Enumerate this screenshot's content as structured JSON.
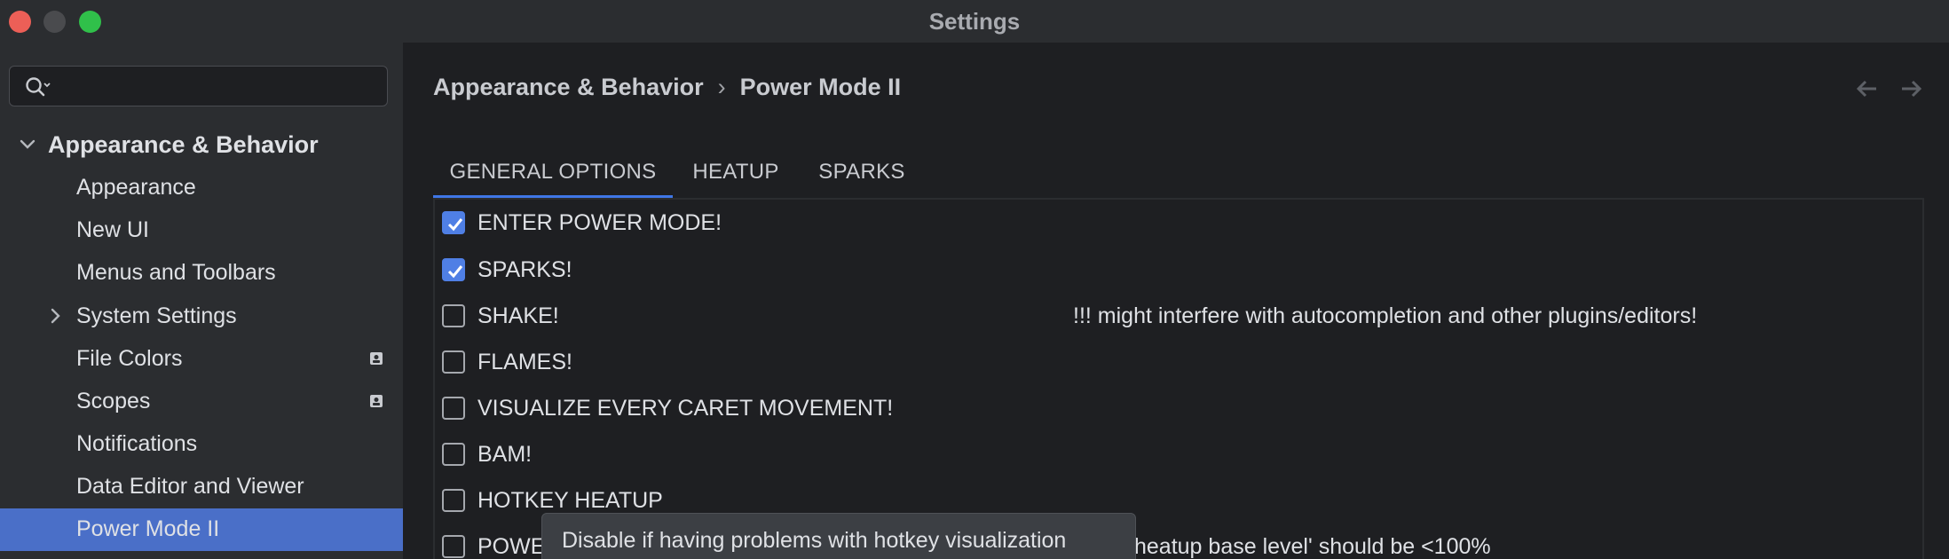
{
  "window": {
    "title": "Settings"
  },
  "search": {
    "placeholder": "",
    "value": ""
  },
  "sidebar": {
    "items": [
      {
        "label": "Appearance & Behavior"
      },
      {
        "label": "Appearance"
      },
      {
        "label": "New UI"
      },
      {
        "label": "Menus and Toolbars"
      },
      {
        "label": "System Settings"
      },
      {
        "label": "File Colors"
      },
      {
        "label": "Scopes"
      },
      {
        "label": "Notifications"
      },
      {
        "label": "Data Editor and Viewer"
      },
      {
        "label": "Power Mode II"
      }
    ]
  },
  "breadcrumb": {
    "parent": "Appearance & Behavior",
    "separator": "›",
    "current": "Power Mode II"
  },
  "tabs": [
    {
      "label": "GENERAL OPTIONS",
      "active": true
    },
    {
      "label": "HEATUP",
      "active": false
    },
    {
      "label": "SPARKS",
      "active": false
    }
  ],
  "options": [
    {
      "label": "ENTER POWER MODE!",
      "checked": true
    },
    {
      "label": "SPARKS!",
      "checked": true
    },
    {
      "label": "SHAKE!",
      "checked": false
    },
    {
      "label": "FLAMES!",
      "checked": false
    },
    {
      "label": "VISUALIZE EVERY CARET MOVEMENT!",
      "checked": false
    },
    {
      "label": "BAM!",
      "checked": false
    },
    {
      "label": "HOTKEY HEATUP",
      "checked": false
    },
    {
      "label": "POWE",
      "checked": false
    }
  ],
  "notes": {
    "shake_warning": "!!! might interfere with autocompletion and other plugins/editors!",
    "heatup_note": "heatup base level' should be <100%"
  },
  "tooltip": {
    "text": "Disable if having problems with hotkey visualization"
  },
  "colors": {
    "accent": "#4f7fe5",
    "selection": "#4a6fc8",
    "background": "#1e1f22",
    "panel": "#2b2d30"
  }
}
